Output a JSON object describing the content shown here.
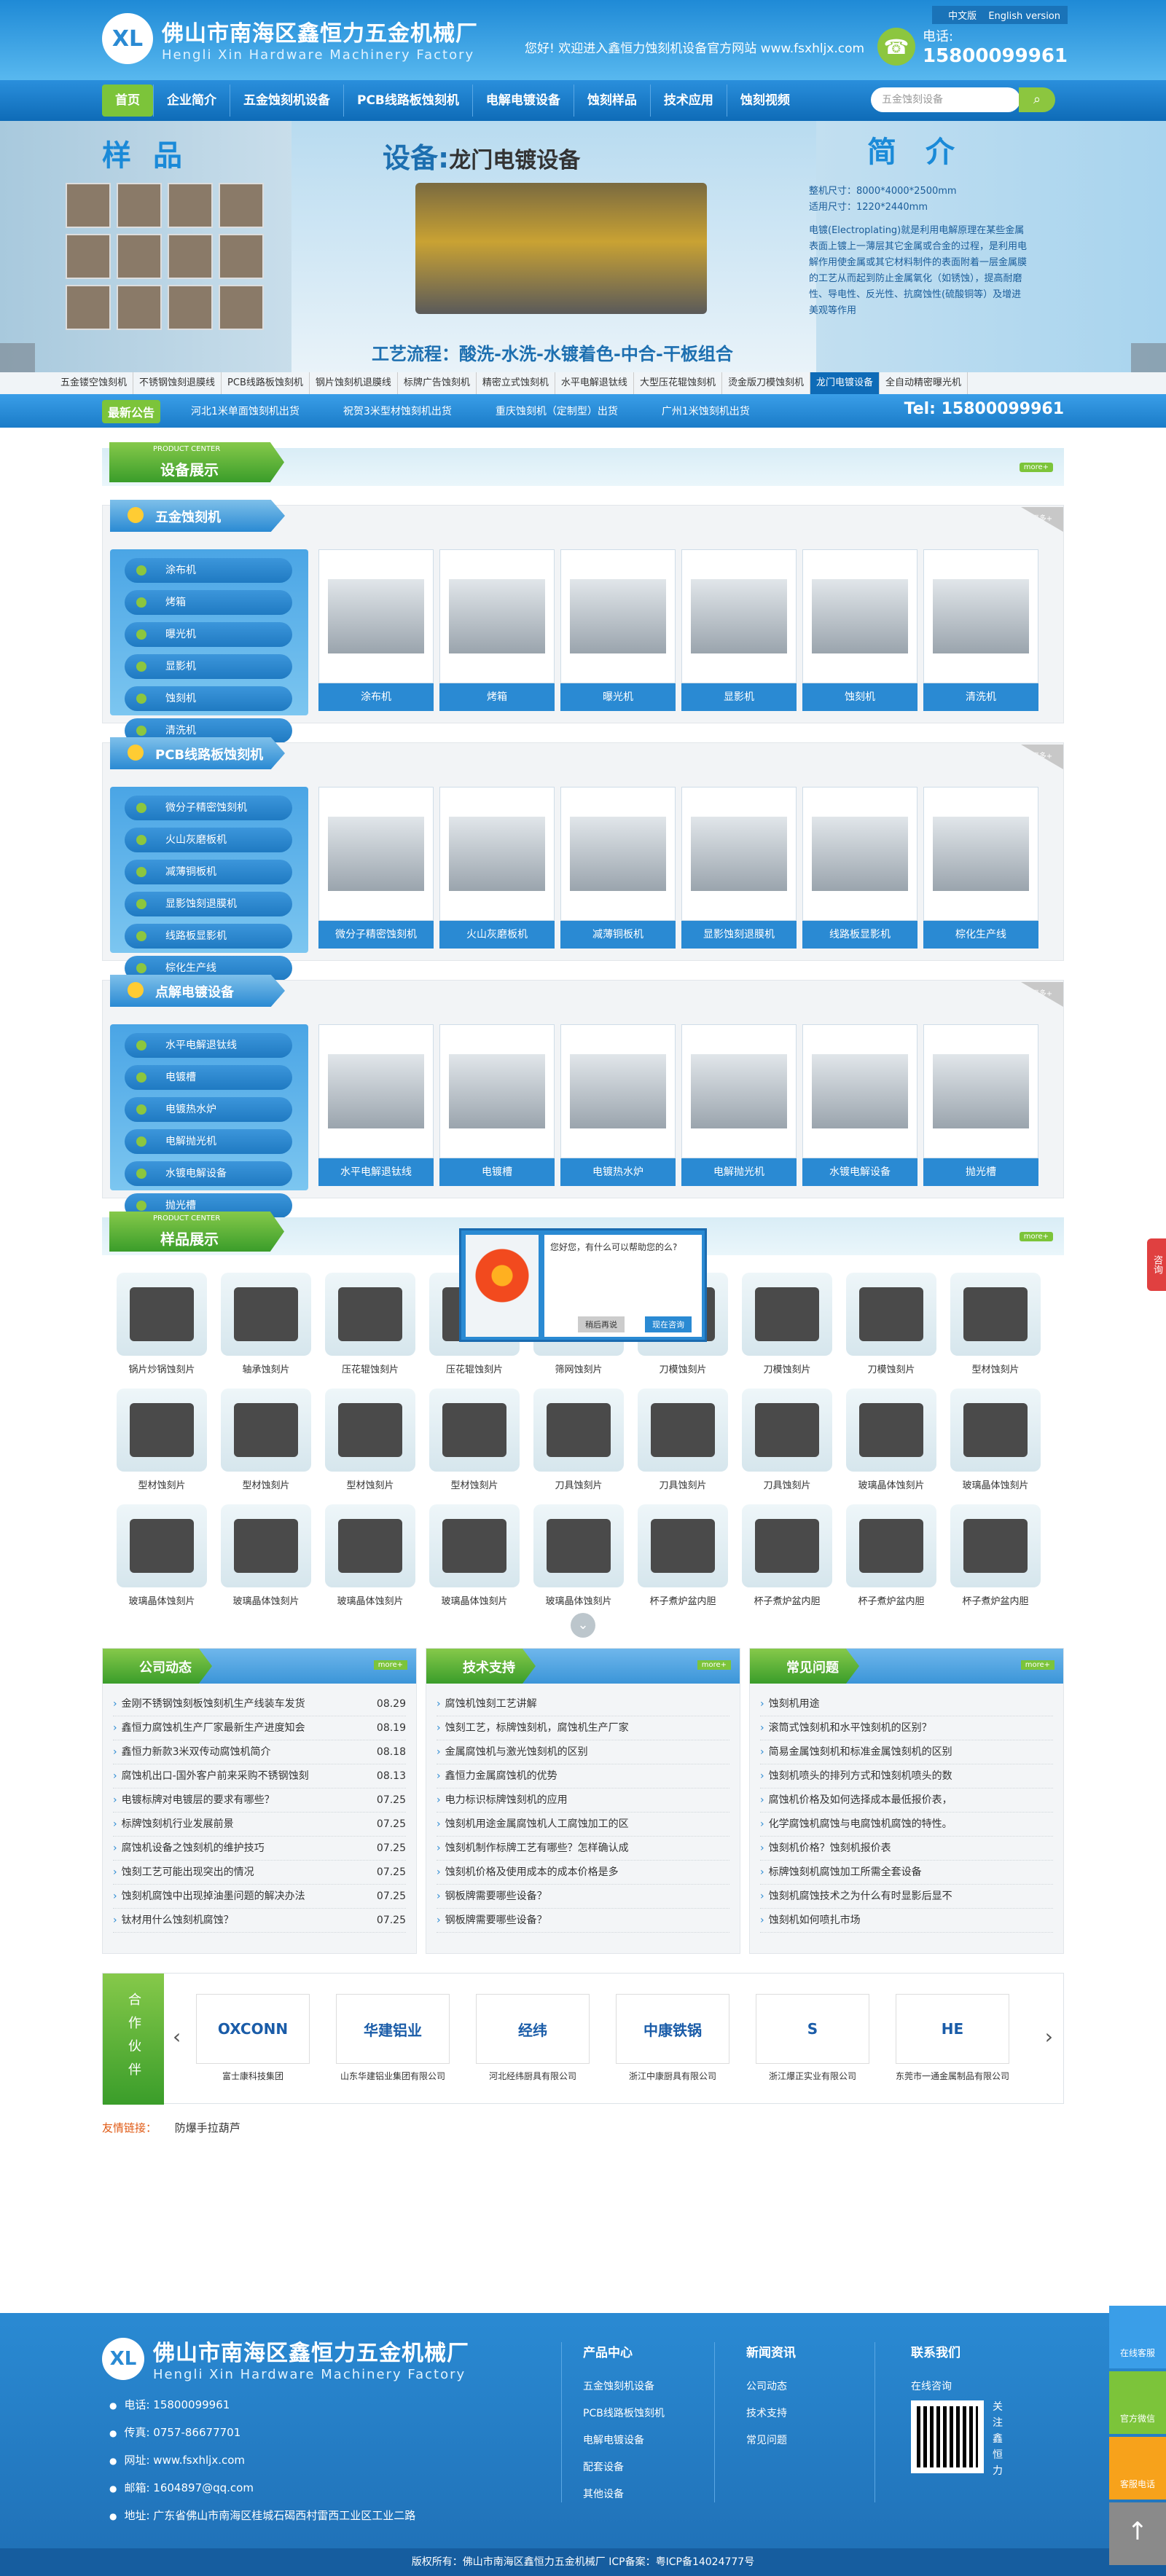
{
  "header": {
    "logo_mark": "XL",
    "company_cn": "佛山市南海区鑫恒力五金机械厂",
    "company_en": "Hengli Xin Hardware Machinery Factory",
    "welcome": "您好! 欢迎进入鑫恒力蚀刻机设备官方网站 www.fsxhljx.com",
    "lang_cn": "中文版",
    "lang_en": "English version",
    "phone_label": "电话:",
    "phone": "15800099961"
  },
  "nav": {
    "items": [
      "首页",
      "企业简介",
      "五金蚀刻机设备",
      "PCB线路板蚀刻机",
      "电解电镀设备",
      "蚀刻样品",
      "技术应用",
      "蚀刻视频"
    ],
    "search_placeholder": "五金蚀刻设备"
  },
  "banner": {
    "left_title": "样品",
    "mid_title": "设备:",
    "mid_subtitle": "龙门电镀设备",
    "process": "工艺流程：酸洗-水洗-水镀着色-中合-干板组合",
    "right_title": "简介",
    "spec1": "整机尺寸：8000*4000*2500mm",
    "spec2": "适用尺寸：1220*2440mm",
    "desc": "电镀(Electroplating)就是利用电解原理在某些金属表面上镀上一薄层其它金属或合金的过程，是利用电解作用使金属或其它材料制件的表面附着一层金属膜的工艺从而起到防止金属氧化（如锈蚀），提高耐磨性、导电性、反光性、抗腐蚀性(硫酸铜等）及增进美观等作用"
  },
  "category_strip": [
    "五金镂空蚀刻机",
    "不锈钢蚀刻退膜线",
    "PCB线路板蚀刻机",
    "钢片蚀刻机退膜线",
    "标牌广告蚀刻机",
    "精密立式蚀刻机",
    "水平电解退钛线",
    "大型压花辊蚀刻机",
    "烫金版刀模蚀刻机",
    "龙门电镀设备",
    "全自动精密曝光机"
  ],
  "ticker": {
    "label": "最新公告",
    "items": [
      "河北1米单面蚀刻机出货",
      "祝贺3米型材蚀刻机出货",
      "重庆蚀刻机（定制型）出货",
      "广州1米蚀刻机出货"
    ],
    "tel": "Tel: 15800099961"
  },
  "products": {
    "small": "PRODUCT CENTER",
    "title": "设备展示",
    "more": "more+",
    "blocks": [
      {
        "title": "五金蚀刻机",
        "menu": [
          "涂布机",
          "烤箱",
          "曝光机",
          "显影机",
          "蚀刻机",
          "清洗机"
        ],
        "items": [
          "涂布机",
          "烤箱",
          "曝光机",
          "显影机",
          "蚀刻机",
          "清洗机"
        ]
      },
      {
        "title": "PCB线路板蚀刻机",
        "menu": [
          "微分子精密蚀刻机",
          "火山灰磨板机",
          "减薄铜板机",
          "显影蚀刻退膜机",
          "线路板显影机",
          "棕化生产线"
        ],
        "items": [
          "微分子精密蚀刻机",
          "火山灰磨板机",
          "减薄铜板机",
          "显影蚀刻退膜机",
          "线路板显影机",
          "棕化生产线"
        ]
      },
      {
        "title": "点解电镀设备",
        "menu": [
          "水平电解退钛线",
          "电镀槽",
          "电镀热水炉",
          "电解抛光机",
          "水镀电解设备",
          "抛光槽"
        ],
        "items": [
          "水平电解退钛线",
          "电镀槽",
          "电镀热水炉",
          "电解抛光机",
          "水镀电解设备",
          "抛光槽"
        ]
      }
    ],
    "block_more": "更多+"
  },
  "samples": {
    "small": "PRODUCT CENTER",
    "title": "样品展示",
    "more": "more+",
    "items": [
      "锅片炒锅蚀刻片",
      "轴承蚀刻片",
      "压花辊蚀刻片",
      "压花辊蚀刻片",
      "筛网蚀刻片",
      "刀模蚀刻片",
      "刀模蚀刻片",
      "刀模蚀刻片",
      "型材蚀刻片",
      "型材蚀刻片",
      "型材蚀刻片",
      "型材蚀刻片",
      "型材蚀刻片",
      "刀具蚀刻片",
      "刀具蚀刻片",
      "刀具蚀刻片",
      "玻璃晶体蚀刻片",
      "玻璃晶体蚀刻片",
      "玻璃晶体蚀刻片",
      "玻璃晶体蚀刻片",
      "玻璃晶体蚀刻片",
      "玻璃晶体蚀刻片",
      "玻璃晶体蚀刻片",
      "杯子煮炉盆内胆",
      "杯子煮炉盆内胆",
      "杯子煮炉盆内胆",
      "杯子煮炉盆内胆"
    ]
  },
  "news": [
    {
      "title": "公司动态",
      "more": "more+",
      "items": [
        [
          "金刚不锈钢蚀刻板蚀刻机生产线装车发货",
          "08.29"
        ],
        [
          "鑫恒力腐蚀机生产厂家最新生产进度知会",
          "08.19"
        ],
        [
          "鑫恒力新款3米双传动腐蚀机简介",
          "08.18"
        ],
        [
          "腐蚀机出口-国外客户前来采购不锈钢蚀刻",
          "08.13"
        ],
        [
          "电镀标牌对电镀层的要求有哪些？",
          "07.25"
        ],
        [
          "标牌蚀刻机行业发展前景",
          "07.25"
        ],
        [
          "腐蚀机设备之蚀刻机的维护技巧",
          "07.25"
        ],
        [
          "蚀刻工艺可能出现突出的情况",
          "07.25"
        ],
        [
          "蚀刻机腐蚀中出现掉油墨问题的解决办法",
          "07.25"
        ],
        [
          "钛材用什么蚀刻机腐蚀？",
          "07.25"
        ]
      ]
    },
    {
      "title": "技术支持",
      "more": "more+",
      "items": [
        [
          "腐蚀机蚀刻工艺讲解",
          ""
        ],
        [
          "蚀刻工艺，标牌蚀刻机，腐蚀机生产厂家",
          ""
        ],
        [
          "金属腐蚀机与激光蚀刻机的区别",
          ""
        ],
        [
          "鑫恒力金属腐蚀机的优势",
          ""
        ],
        [
          "电力标识标牌蚀刻机的应用",
          ""
        ],
        [
          "蚀刻机用途金属腐蚀机人工腐蚀加工的区",
          ""
        ],
        [
          "蚀刻机制作标牌工艺有哪些？怎样确认成",
          ""
        ],
        [
          "蚀刻机价格及使用成本的成本价格是多",
          ""
        ],
        [
          "钢板牌需要哪些设备？",
          ""
        ],
        [
          "钢板牌需要哪些设备？",
          ""
        ]
      ]
    },
    {
      "title": "常见问题",
      "more": "more+",
      "items": [
        [
          "蚀刻机用途",
          ""
        ],
        [
          "滚筒式蚀刻机和水平蚀刻机的区别？",
          ""
        ],
        [
          "简易金属蚀刻机和标准金属蚀刻机的区别",
          ""
        ],
        [
          "蚀刻机喷头的排列方式和蚀刻机喷头的数",
          ""
        ],
        [
          "腐蚀机价格及如何选择成本最低报价表，",
          ""
        ],
        [
          "化学腐蚀机腐蚀与电腐蚀机腐蚀的特性。",
          ""
        ],
        [
          "蚀刻机价格？蚀刻机报价表",
          ""
        ],
        [
          "标牌蚀刻机腐蚀加工所需全套设备",
          ""
        ],
        [
          "蚀刻机腐蚀技术之为什么有时显影后显不",
          ""
        ],
        [
          "蚀刻机如何喷扎市场",
          ""
        ]
      ]
    }
  ],
  "partners": {
    "tag": "合作伙伴",
    "items": [
      {
        "logo": "OXCONN",
        "name": "富士康科技集团"
      },
      {
        "logo": "华建铝业",
        "name": "山东华建铝业集团有限公司"
      },
      {
        "logo": "经纬",
        "name": "河北经纬厨具有限公司"
      },
      {
        "logo": "中康铁锅",
        "name": "浙江中康厨具有限公司"
      },
      {
        "logo": "S",
        "name": "浙江爆正实业有限公司"
      },
      {
        "logo": "HE",
        "name": "东莞市一通金属制品有限公司"
      }
    ]
  },
  "links": {
    "label": "友情链接：",
    "items": [
      "防爆手拉葫芦"
    ]
  },
  "chat": {
    "msg": "您好您，有什么可以帮助您的么?",
    "later": "稍后再说",
    "now": "现在咨询"
  },
  "consult": "咨询",
  "footer": {
    "company_cn": "佛山市南海区鑫恒力五金机械厂",
    "company_en": "Hengli Xin Hardware Machinery Factory",
    "tel": "电话: 15800099961",
    "fax": "传真: 0757-86677701",
    "web": "网址: www.fsxhljx.com",
    "mail": "邮箱: 1604897@qq.com",
    "addr": "地址: 广东省佛山市南海区桂城石碣西村雷西工业区工业二路",
    "col1_title": "产品中心",
    "col1": [
      "五金蚀刻机设备",
      "PCB线路板蚀刻机",
      "电解电镀设备",
      "配套设备",
      "其他设备"
    ],
    "col2_title": "新闻资讯",
    "col2": [
      "公司动态",
      "技术支持",
      "常见问题"
    ],
    "col3_title": "联系我们",
    "col3": [
      "在线咨询"
    ],
    "qr_text": "关注鑫恒力",
    "copyright": "版权所有：佛山市南海区鑫恒力五金机械厂    ICP备案：粤ICP备14024777号"
  },
  "float": [
    "在线客服",
    "官方微信",
    "客服电话",
    ""
  ]
}
